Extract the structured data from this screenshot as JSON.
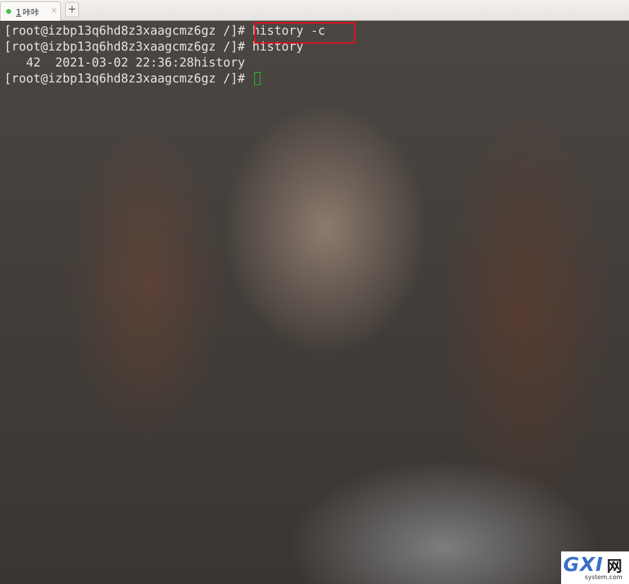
{
  "tabs": [
    {
      "number": "1",
      "title": "咔咔",
      "status_color": "#3fc13f",
      "close": "×"
    }
  ],
  "new_tab_label": "+",
  "terminal": {
    "lines": [
      {
        "prompt": "[root@izbp13q6hd8z3xaagcmz6gz /]# ",
        "command": "history -c"
      },
      {
        "prompt": "[root@izbp13q6hd8z3xaagcmz6gz /]# ",
        "command": "history"
      },
      {
        "text": "   42  2021-03-02 22:36:28history"
      },
      {
        "prompt": "[root@izbp13q6hd8z3xaagcmz6gz /]# ",
        "command": ""
      }
    ],
    "highlight_color": "#e4101a",
    "cursor_color": "#27c427"
  },
  "watermark": {
    "logo": "GXI",
    "cn": "网",
    "domain": "system.com"
  }
}
